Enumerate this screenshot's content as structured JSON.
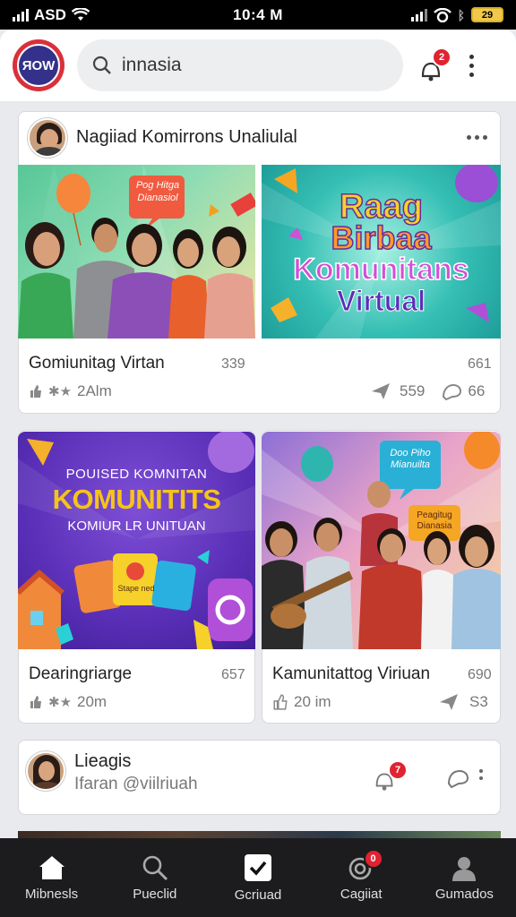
{
  "status_bar": {
    "carrier": "ASD",
    "time": "10:4 M",
    "battery": "29"
  },
  "header": {
    "logo_text": "ЯOW",
    "search_value": "innasia",
    "notification_badge": "2"
  },
  "post": {
    "author": "Nagiiad Komirrons Unaliulal",
    "tiles": [
      {
        "title": "Gomiunitag Virtan",
        "count": "339",
        "meta": "2Alm",
        "count_right": "661",
        "shares": "559",
        "comments": "66",
        "image_sign": "Pog Hitga Dianasiol"
      },
      {
        "title": "",
        "image_text": [
          "Raag",
          "Birbaa",
          "Komunitans",
          "Virtual"
        ]
      },
      {
        "title": "Dearingriarge",
        "count": "657",
        "meta": "20m",
        "image_text": [
          "POUISED KOMNITAN",
          "KOMUNITITS",
          "KOMIUR LR UNITUAN"
        ],
        "card_label": "Stape ned"
      },
      {
        "title": "Kamunitattog Viriuan",
        "count": "690",
        "meta": "20 im",
        "shares": "S3",
        "image_signs": [
          "Doo Piho Mianuilta",
          "Peagitug Dianasia"
        ]
      }
    ]
  },
  "comment": {
    "name": "Lieagis",
    "handle": "Ifaran @viilriuah",
    "badge": "7"
  },
  "nav": {
    "items": [
      {
        "label": "Mibnesls"
      },
      {
        "label": "Pueclid"
      },
      {
        "label": "Gcriuad"
      },
      {
        "label": "Cagiiat",
        "badge": "0"
      },
      {
        "label": "Gumados"
      }
    ]
  },
  "colors": {
    "accent_red": "#e02331",
    "logo_blue": "#33318a",
    "nav_bg": "#1c1c1e"
  }
}
